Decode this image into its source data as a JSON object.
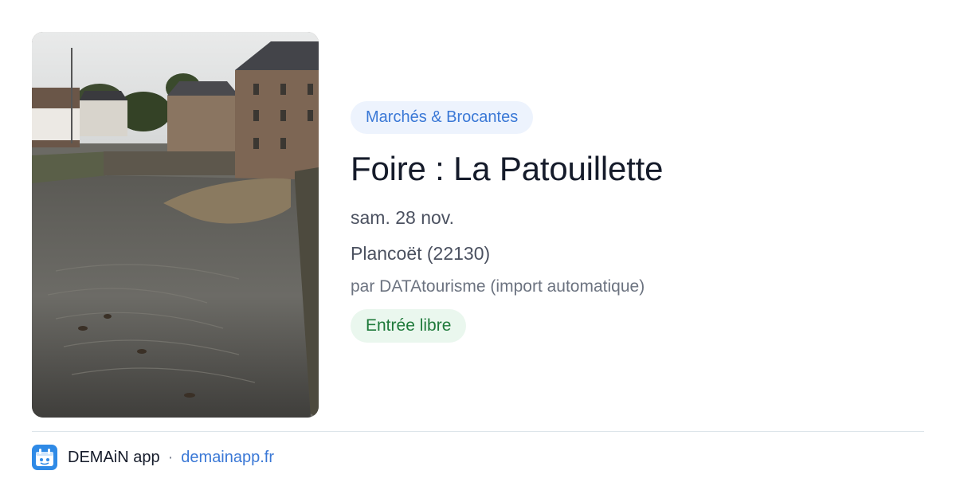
{
  "event": {
    "image": {
      "description_name": "photo-river-town"
    },
    "category": "Marchés & Brocantes",
    "title": "Foire : La Patouillette",
    "date": "sam. 28 nov.",
    "location": "Plancoët (22130)",
    "author": "par DATAtourisme (import automatique)",
    "price": "Entrée libre"
  },
  "footer": {
    "app_name": "DEMAiN app",
    "separator": "·",
    "site": "demainapp.fr"
  },
  "colors": {
    "accent": "#3a78d6",
    "category_bg": "#edf3fd",
    "price_text": "#1f7a3b",
    "price_bg": "#eaf7ee",
    "title": "#151b2a"
  }
}
